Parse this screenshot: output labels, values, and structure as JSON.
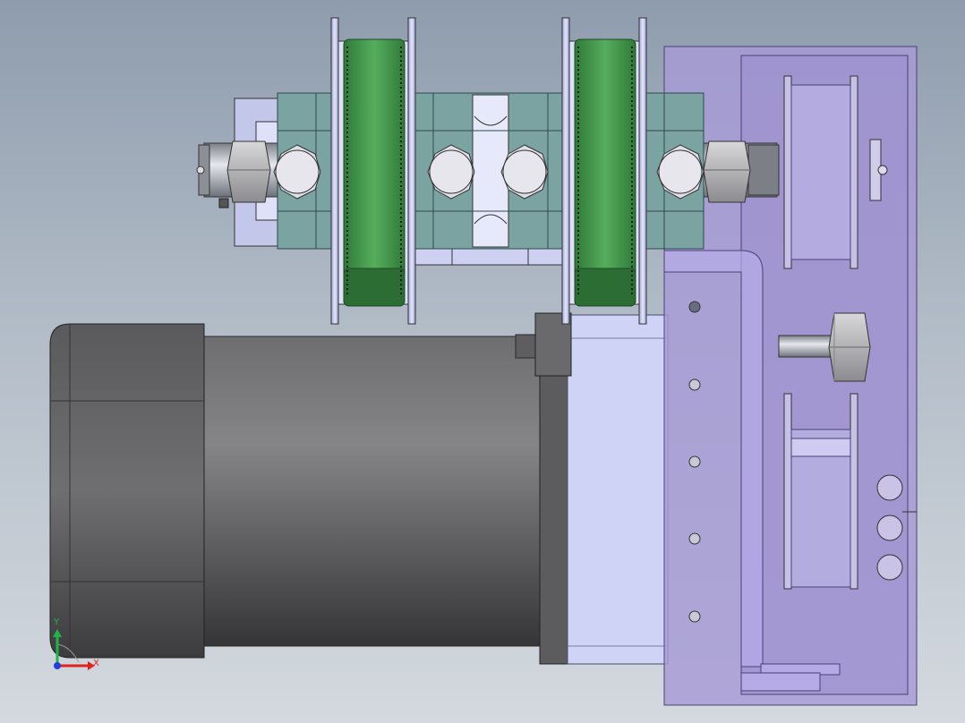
{
  "colors": {
    "motor_dark": "#505050",
    "motor_mid": "#7a7a7b",
    "pulley_green": "#3f9a4b",
    "bearing_teal": "#7aa3a1",
    "nut_grey": "#b8b8ba",
    "plate_purple": "#a79bd6",
    "flange_lavender": "#c8cdf0",
    "axis_x": "#e0231f",
    "axis_y": "#1fb34a",
    "axis_origin": "#2040d8"
  },
  "triad": {
    "x_label": "X",
    "y_label": "Y"
  }
}
